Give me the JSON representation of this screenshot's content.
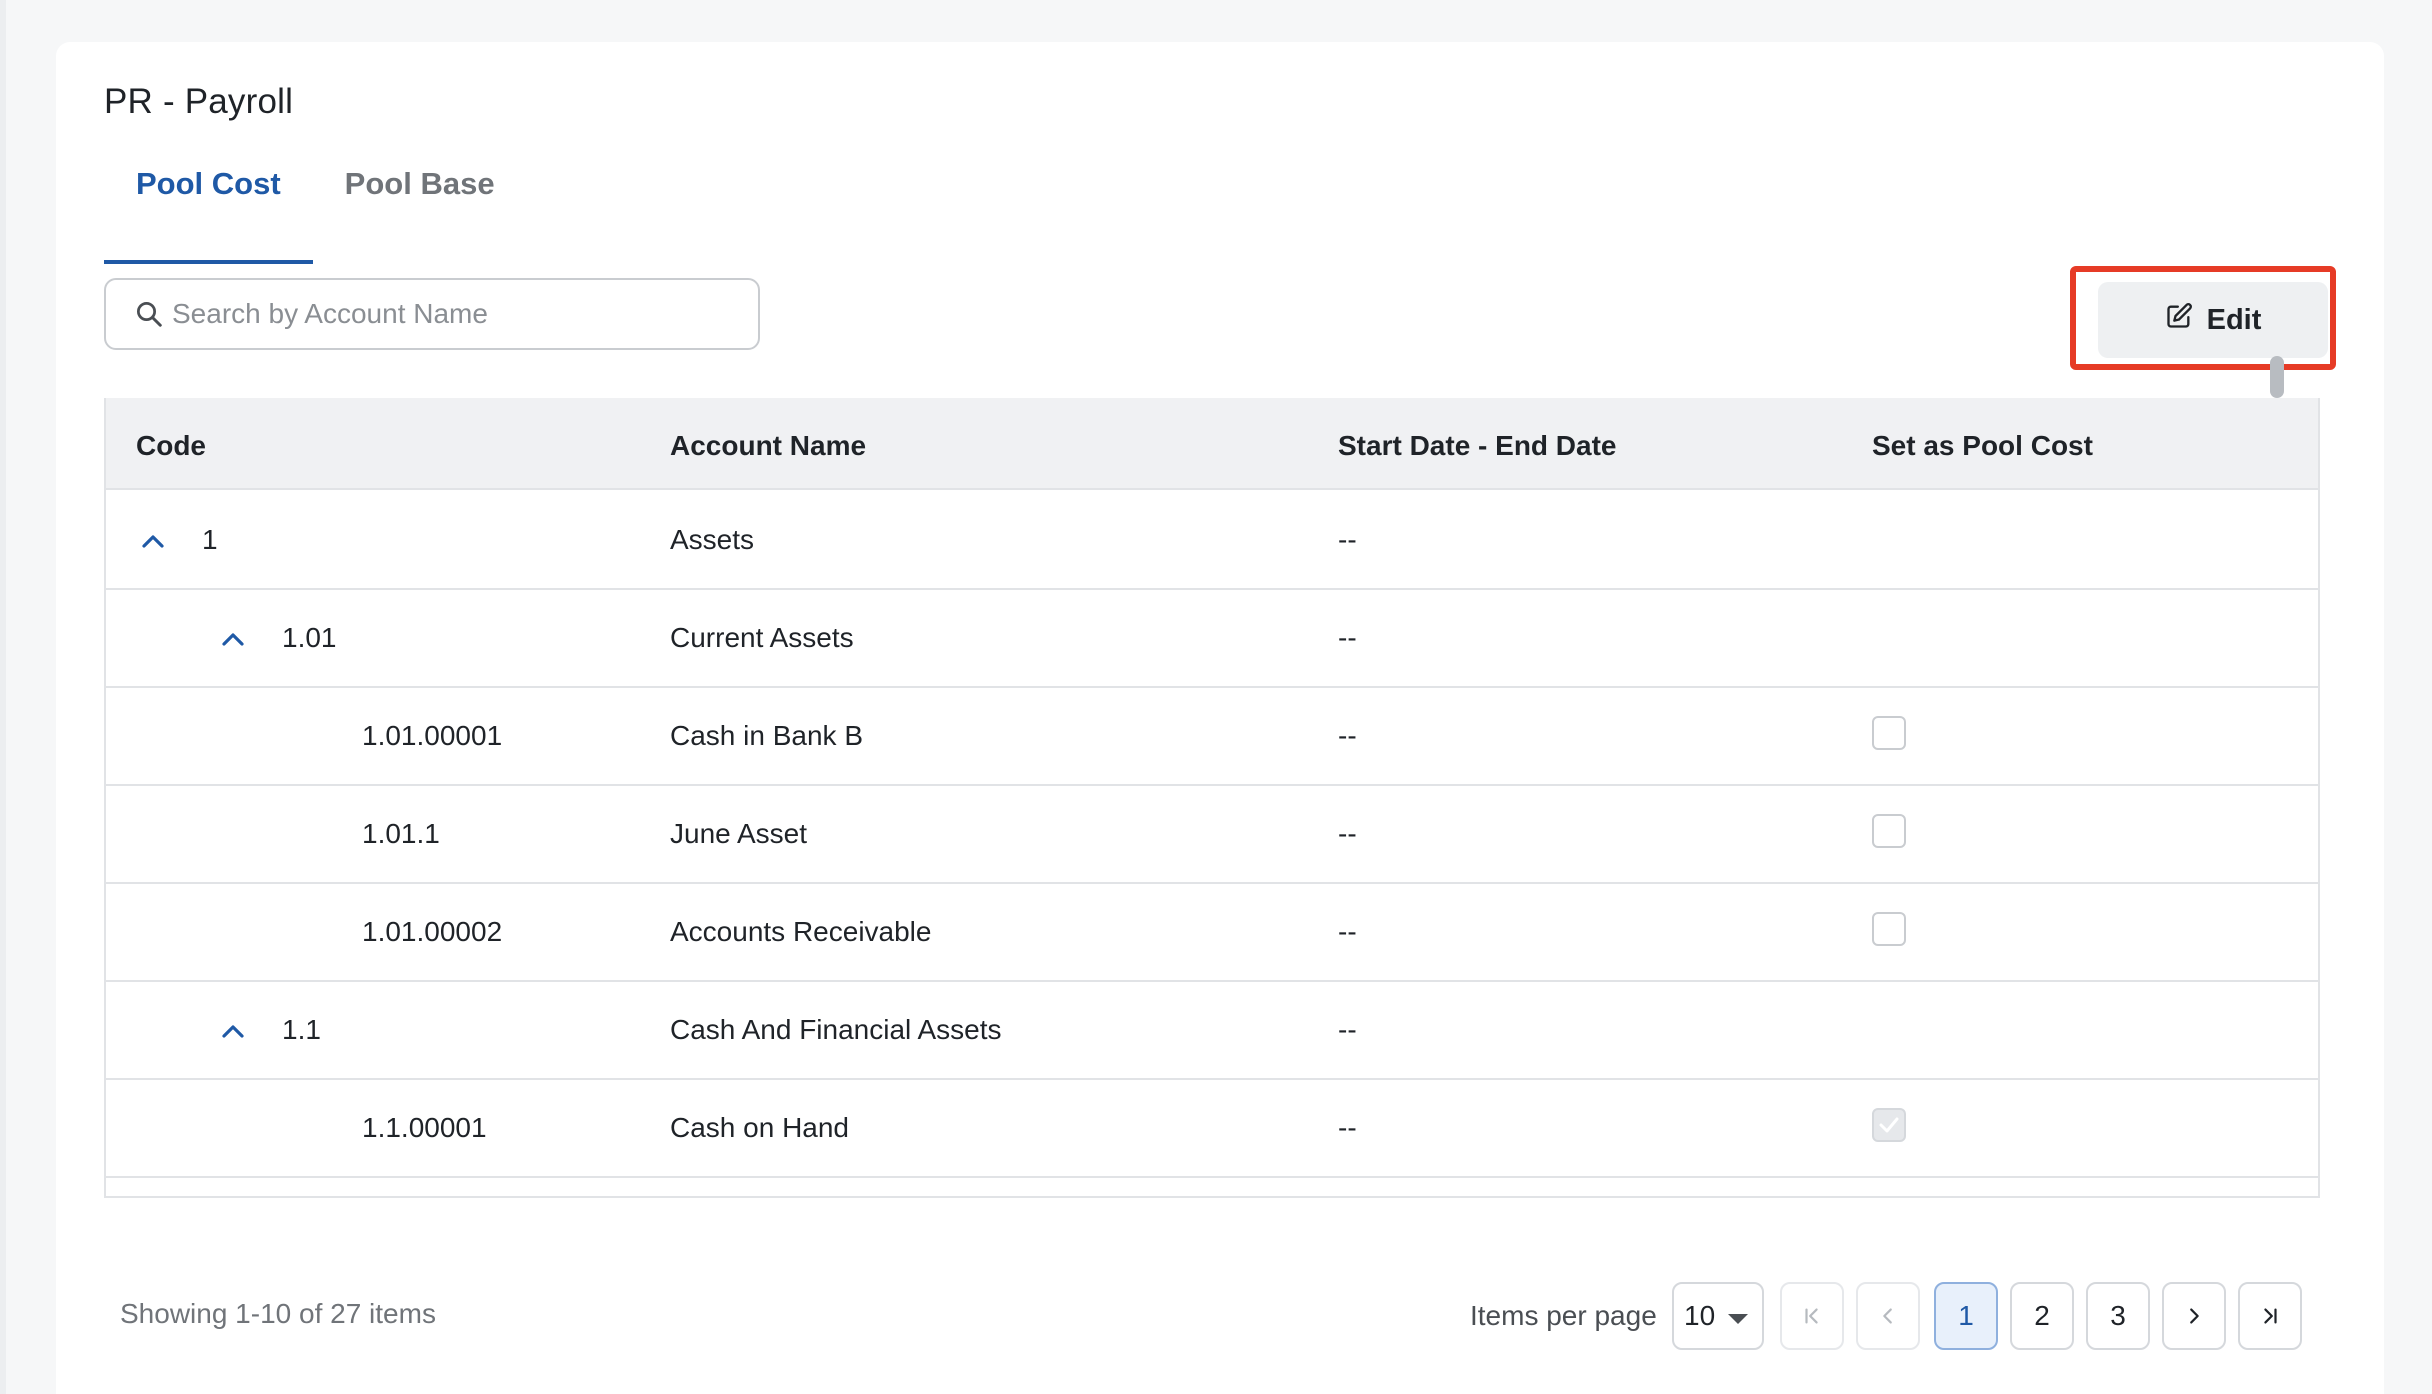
{
  "page": {
    "title": "PR - Payroll"
  },
  "tabs": [
    {
      "label": "Pool Cost",
      "active": true
    },
    {
      "label": "Pool Base",
      "active": false
    }
  ],
  "search": {
    "placeholder": "Search by Account Name",
    "value": ""
  },
  "toolbar": {
    "edit_label": "Edit"
  },
  "table": {
    "headers": [
      "Code",
      "Account Name",
      "Start Date - End Date",
      "Set as Pool Cost"
    ],
    "rows": [
      {
        "code": "1",
        "name": "Assets",
        "dates": "--",
        "level": 0,
        "expandable": true,
        "checkbox": null
      },
      {
        "code": "1.01",
        "name": "Current Assets",
        "dates": "--",
        "level": 1,
        "expandable": true,
        "checkbox": null
      },
      {
        "code": "1.01.00001",
        "name": "Cash in Bank B",
        "dates": "--",
        "level": 2,
        "expandable": false,
        "checkbox": "unchecked"
      },
      {
        "code": "1.01.1",
        "name": "June Asset",
        "dates": "--",
        "level": 2,
        "expandable": false,
        "checkbox": "unchecked"
      },
      {
        "code": "1.01.00002",
        "name": "Accounts Receivable",
        "dates": "--",
        "level": 2,
        "expandable": false,
        "checkbox": "unchecked"
      },
      {
        "code": "1.1",
        "name": "Cash And Financial Assets",
        "dates": "--",
        "level": 1,
        "expandable": true,
        "checkbox": null
      },
      {
        "code": "1.1.00001",
        "name": "Cash on Hand",
        "dates": "--",
        "level": 2,
        "expandable": false,
        "checkbox": "checked-disabled"
      }
    ]
  },
  "footer": {
    "summary": "Showing 1-10 of 27 items",
    "items_per_page_label": "Items per page",
    "items_per_page_value": "10",
    "pages": [
      "1",
      "2",
      "3"
    ],
    "current_page": "1"
  },
  "colors": {
    "accent": "#1f59a6",
    "highlight_frame": "#e63b26"
  }
}
